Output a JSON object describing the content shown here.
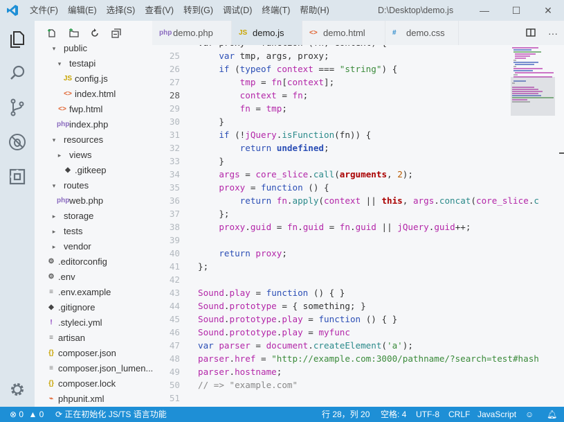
{
  "titlebar": {
    "menu": [
      "文件(F)",
      "编辑(E)",
      "选择(S)",
      "查看(V)",
      "转到(G)",
      "调试(D)",
      "终端(T)",
      "帮助(H)"
    ],
    "title": "D:\\Desktop\\demo.js"
  },
  "activity": [
    "explorer",
    "search",
    "source-control",
    "debug",
    "extensions",
    "settings"
  ],
  "sidebar": {
    "toolbar": [
      "new-file",
      "new-folder",
      "refresh",
      "collapse-all"
    ],
    "tree": [
      {
        "label": "public",
        "type": "folder",
        "open": true
      },
      {
        "label": "testapi",
        "type": "folder",
        "open": true
      },
      {
        "label": "config.js",
        "type": "js",
        "icon": "JS"
      },
      {
        "label": "index.html",
        "type": "html",
        "icon": "<>"
      },
      {
        "label": "fwp.html",
        "type": "html",
        "icon": "<>"
      },
      {
        "label": "index.php",
        "type": "php",
        "icon": "php"
      },
      {
        "label": "resources",
        "type": "folder",
        "open": true
      },
      {
        "label": "views",
        "type": "folder",
        "open": false
      },
      {
        "label": ".gitkeep",
        "type": "git",
        "icon": "◆"
      },
      {
        "label": "routes",
        "type": "folder",
        "open": true
      },
      {
        "label": "web.php",
        "type": "php",
        "icon": "php"
      },
      {
        "label": "storage",
        "type": "folder",
        "open": false
      },
      {
        "label": "tests",
        "type": "folder",
        "open": false
      },
      {
        "label": "vendor",
        "type": "folder",
        "open": false
      },
      {
        "label": ".editorconfig",
        "type": "gear",
        "icon": "⚙"
      },
      {
        "label": ".env",
        "type": "gear",
        "icon": "⚙"
      },
      {
        "label": ".env.example",
        "type": "text",
        "icon": "≡"
      },
      {
        "label": ".gitignore",
        "type": "git",
        "icon": "◆"
      },
      {
        "label": ".styleci.yml",
        "type": "yml",
        "icon": "!"
      },
      {
        "label": "artisan",
        "type": "text",
        "icon": "≡"
      },
      {
        "label": "composer.json",
        "type": "json",
        "icon": "{}"
      },
      {
        "label": "composer.json_lumen...",
        "type": "text",
        "icon": "≡"
      },
      {
        "label": "composer.lock",
        "type": "json",
        "icon": "{}"
      },
      {
        "label": "phpunit.xml",
        "type": "xml",
        "icon": "⌁"
      }
    ]
  },
  "tabs": [
    {
      "label": "demo.php",
      "icon": "php",
      "active": false
    },
    {
      "label": "demo.js",
      "icon": "JS",
      "active": true
    },
    {
      "label": "demo.html",
      "icon": "<>",
      "active": false
    },
    {
      "label": "demo.css",
      "icon": "#",
      "active": false
    }
  ],
  "editor": {
    "current_line": 28,
    "lines": [
      {
        "n": "",
        "t": [
          [
            "d",
            "var proxy = function (fn, context) {"
          ]
        ]
      },
      {
        "n": "25",
        "t": [
          [
            "k",
            "    var"
          ],
          [
            "d",
            " tmp, args, proxy;"
          ]
        ]
      },
      {
        "n": "26",
        "t": [
          [
            "k",
            "    if"
          ],
          [
            "d",
            " ("
          ],
          [
            "k",
            "typeof"
          ],
          [
            "p",
            " context"
          ],
          [
            "d",
            " === "
          ],
          [
            "s",
            "\"string\""
          ],
          [
            "d",
            ") {"
          ]
        ]
      },
      {
        "n": "27",
        "t": [
          [
            "p",
            "        tmp"
          ],
          [
            "d",
            " = "
          ],
          [
            "p",
            "fn"
          ],
          [
            "d",
            "["
          ],
          [
            "p",
            "context"
          ],
          [
            "d",
            "];"
          ]
        ]
      },
      {
        "n": "28",
        "t": [
          [
            "p",
            "        context"
          ],
          [
            "d",
            " = "
          ],
          [
            "p",
            "fn"
          ],
          [
            "d",
            ";"
          ]
        ]
      },
      {
        "n": "29",
        "t": [
          [
            "p",
            "        fn"
          ],
          [
            "d",
            " = "
          ],
          [
            "p",
            "tmp"
          ],
          [
            "d",
            ";"
          ]
        ]
      },
      {
        "n": "30",
        "t": [
          [
            "d",
            "    }"
          ]
        ]
      },
      {
        "n": "31",
        "t": [
          [
            "k",
            "    if"
          ],
          [
            "d",
            " (!"
          ],
          [
            "p",
            "jQuery"
          ],
          [
            "d",
            "."
          ],
          [
            "f",
            "isFunction"
          ],
          [
            "d",
            "(fn)) {"
          ]
        ]
      },
      {
        "n": "32",
        "t": [
          [
            "k",
            "        return"
          ],
          [
            "b",
            " undefined"
          ],
          [
            "d",
            ";"
          ]
        ]
      },
      {
        "n": "33",
        "t": [
          [
            "d",
            "    }"
          ]
        ]
      },
      {
        "n": "34",
        "t": [
          [
            "p",
            "    args"
          ],
          [
            "d",
            " = "
          ],
          [
            "p",
            "core_slice"
          ],
          [
            "d",
            "."
          ],
          [
            "f",
            "call"
          ],
          [
            "d",
            "("
          ],
          [
            "bd",
            "arguments"
          ],
          [
            "d",
            ", "
          ],
          [
            "r",
            "2"
          ],
          [
            "d",
            ");"
          ]
        ]
      },
      {
        "n": "35",
        "t": [
          [
            "p",
            "    proxy"
          ],
          [
            "d",
            " = "
          ],
          [
            "k",
            "function"
          ],
          [
            "d",
            " () {"
          ]
        ]
      },
      {
        "n": "36",
        "t": [
          [
            "k",
            "        return"
          ],
          [
            "p",
            " fn"
          ],
          [
            "d",
            "."
          ],
          [
            "f",
            "apply"
          ],
          [
            "d",
            "("
          ],
          [
            "p",
            "context"
          ],
          [
            "d",
            " || "
          ],
          [
            "bd",
            "this"
          ],
          [
            "d",
            ", "
          ],
          [
            "p",
            "args"
          ],
          [
            "d",
            "."
          ],
          [
            "f",
            "concat"
          ],
          [
            "d",
            "("
          ],
          [
            "p",
            "core_slice"
          ],
          [
            "d",
            "."
          ],
          [
            "f",
            "c"
          ]
        ]
      },
      {
        "n": "37",
        "t": [
          [
            "d",
            "    };"
          ]
        ]
      },
      {
        "n": "38",
        "t": [
          [
            "p",
            "    proxy"
          ],
          [
            "d",
            "."
          ],
          [
            "p",
            "guid"
          ],
          [
            "d",
            " = "
          ],
          [
            "p",
            "fn"
          ],
          [
            "d",
            "."
          ],
          [
            "p",
            "guid"
          ],
          [
            "d",
            " = "
          ],
          [
            "p",
            "fn"
          ],
          [
            "d",
            "."
          ],
          [
            "p",
            "guid"
          ],
          [
            "d",
            " || "
          ],
          [
            "p",
            "jQuery"
          ],
          [
            "d",
            "."
          ],
          [
            "p",
            "guid"
          ],
          [
            "d",
            "++;"
          ]
        ]
      },
      {
        "n": "39",
        "t": []
      },
      {
        "n": "40",
        "t": [
          [
            "k",
            "    return"
          ],
          [
            "p",
            " proxy"
          ],
          [
            "d",
            ";"
          ]
        ]
      },
      {
        "n": "41",
        "t": [
          [
            "d",
            "};"
          ]
        ]
      },
      {
        "n": "42",
        "t": []
      },
      {
        "n": "43",
        "t": [
          [
            "p",
            "Sound"
          ],
          [
            "d",
            "."
          ],
          [
            "p",
            "play"
          ],
          [
            "d",
            " = "
          ],
          [
            "k",
            "function"
          ],
          [
            "d",
            " () { }"
          ]
        ]
      },
      {
        "n": "44",
        "t": [
          [
            "p",
            "Sound"
          ],
          [
            "d",
            "."
          ],
          [
            "p",
            "prototype"
          ],
          [
            "d",
            " = { something; }"
          ]
        ]
      },
      {
        "n": "45",
        "t": [
          [
            "p",
            "Sound"
          ],
          [
            "d",
            "."
          ],
          [
            "p",
            "prototype"
          ],
          [
            "d",
            "."
          ],
          [
            "p",
            "play"
          ],
          [
            "d",
            " = "
          ],
          [
            "k",
            "function"
          ],
          [
            "d",
            " () { }"
          ]
        ]
      },
      {
        "n": "46",
        "t": [
          [
            "p",
            "Sound"
          ],
          [
            "d",
            "."
          ],
          [
            "p",
            "prototype"
          ],
          [
            "d",
            "."
          ],
          [
            "p",
            "play"
          ],
          [
            "d",
            " = "
          ],
          [
            "p",
            "myfunc"
          ]
        ]
      },
      {
        "n": "47",
        "t": [
          [
            "k",
            "var"
          ],
          [
            "p",
            " parser"
          ],
          [
            "d",
            " = "
          ],
          [
            "p",
            "document"
          ],
          [
            "d",
            "."
          ],
          [
            "f",
            "createElement"
          ],
          [
            "d",
            "("
          ],
          [
            "s",
            "'a'"
          ],
          [
            "d",
            ");"
          ]
        ]
      },
      {
        "n": "48",
        "t": [
          [
            "p",
            "parser"
          ],
          [
            "d",
            "."
          ],
          [
            "p",
            "href"
          ],
          [
            "d",
            " = "
          ],
          [
            "s",
            "\"http://example.com:3000/pathname/?search=test#hash"
          ]
        ]
      },
      {
        "n": "49",
        "t": [
          [
            "p",
            "parser"
          ],
          [
            "d",
            "."
          ],
          [
            "p",
            "hostname"
          ],
          [
            "d",
            ";"
          ]
        ]
      },
      {
        "n": "50",
        "t": [
          [
            "c",
            "// => \"example.com\""
          ]
        ]
      },
      {
        "n": "51",
        "t": []
      }
    ]
  },
  "status": {
    "errors": "0",
    "warnings": "0",
    "task": "正在初始化 JS/TS 语言功能",
    "position": "行 28，列 20",
    "spaces": "空格: 4",
    "encoding": "UTF-8",
    "eol": "CRLF",
    "language": "JavaScript"
  },
  "colors": {
    "accent": "#1e8fd6",
    "statusbar": "#1e8fd6",
    "activitybar": "#dde6ed",
    "sidebar": "#f6f7f9"
  }
}
